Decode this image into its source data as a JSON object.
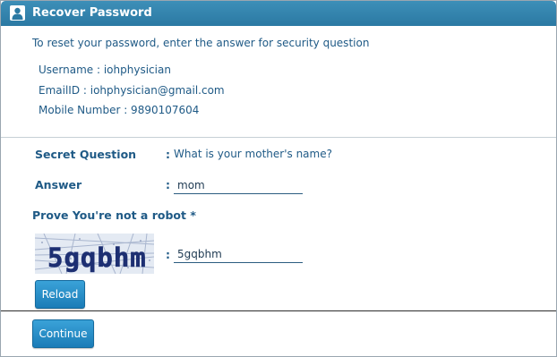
{
  "window": {
    "title": "Recover Password",
    "icon": "user-icon"
  },
  "info": {
    "intro": "To reset your password, enter the answer for security question",
    "username": "Username : iohphysician",
    "email": "EmailID : iohphysician@gmail.com",
    "mobile": "Mobile Number : 9890107604"
  },
  "form": {
    "secret_question_label": "Secret Question",
    "colon": ":",
    "secret_question_value": "What is your mother's name?",
    "answer_label": "Answer",
    "answer_value": "mom",
    "robot_label": "Prove You're not a robot *",
    "captcha_text": "5gqbhm",
    "captcha_value": "5gqbhm",
    "reload_label": "Reload",
    "continue_label": "Continue"
  },
  "colors": {
    "titlebar": "#2b79a3",
    "text": "#1f5a86",
    "button": "#1a7cb7"
  }
}
